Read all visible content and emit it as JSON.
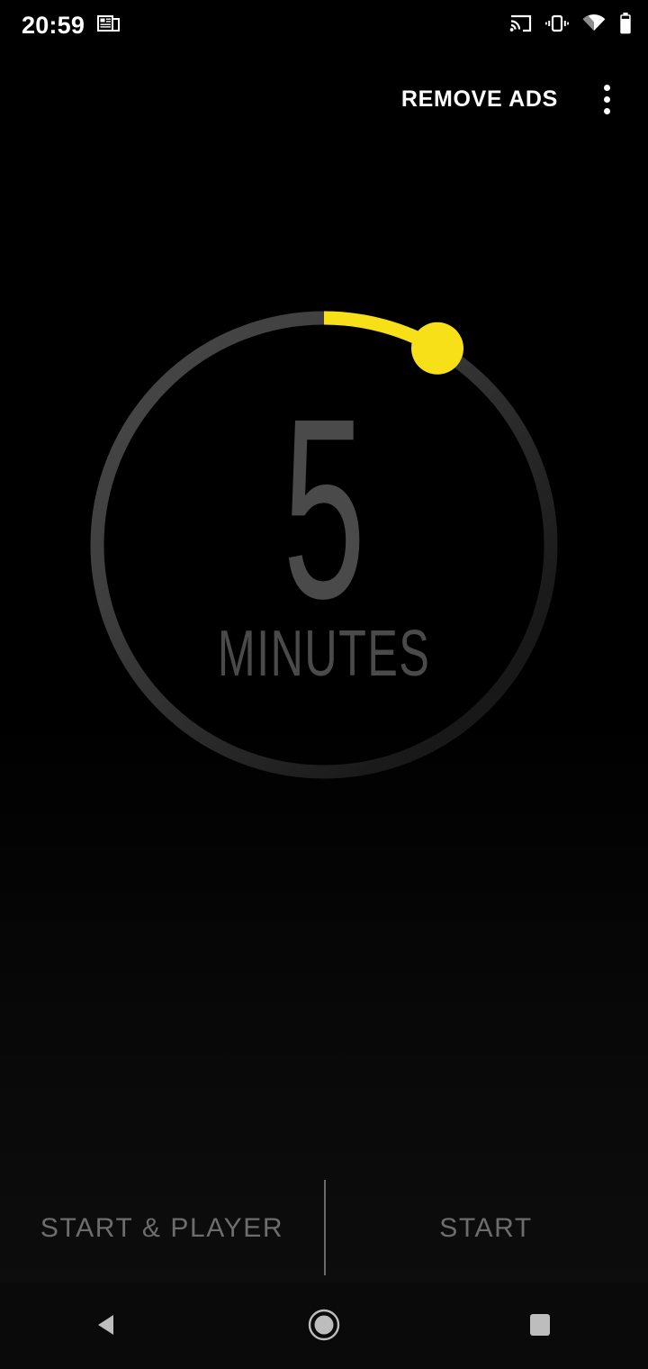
{
  "status_bar": {
    "time": "20:59",
    "notification_icons": [
      "article-icon"
    ],
    "system_icons": [
      "cast-icon",
      "vibrate-icon",
      "wifi-icon",
      "battery-icon"
    ]
  },
  "app_bar": {
    "remove_ads_label": "REMOVE ADS",
    "overflow_menu_label": "More options"
  },
  "timer": {
    "value": "5",
    "unit": "MINUTES",
    "minutes": 5,
    "max_minutes": 60,
    "progress_fraction": 0.0833,
    "arc_start_deg": 0,
    "arc_sweep_deg": 30,
    "accent_color": "#F7E018",
    "track_color": "#454545",
    "track_color_dim": "#151515",
    "digit_color": "#4A4A4A"
  },
  "actions": {
    "primary_label": "START & PLAYER",
    "secondary_label": "START"
  },
  "nav_bar": {
    "back_label": "Back",
    "home_label": "Home",
    "recents_label": "Recents",
    "icon_color": "#BDBDBD"
  },
  "background": {
    "color": "#000000"
  }
}
